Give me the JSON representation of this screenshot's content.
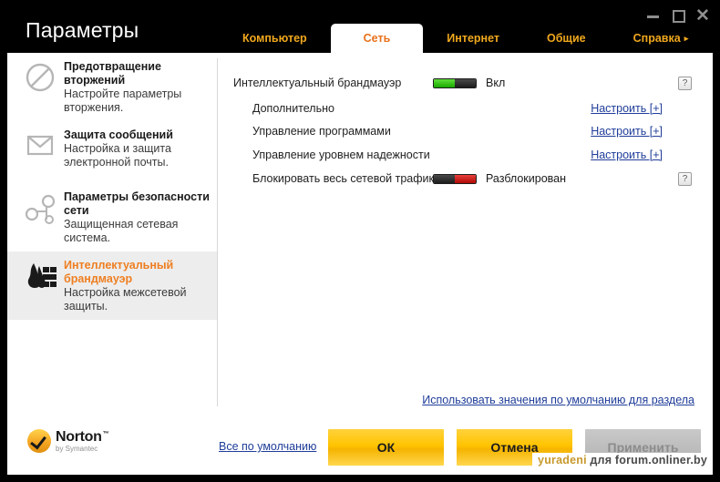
{
  "window": {
    "title": "Параметры",
    "controls": {
      "minimize": "minimize-icon",
      "maximize": "maximize-icon",
      "close": "close-icon"
    }
  },
  "tabs": [
    {
      "label": "Компьютер",
      "active": false,
      "caret": ""
    },
    {
      "label": "Сеть",
      "active": true,
      "caret": ""
    },
    {
      "label": "Интернет",
      "active": false,
      "caret": ""
    },
    {
      "label": "Общие",
      "active": false,
      "caret": ""
    },
    {
      "label": "Справка",
      "active": false,
      "caret": "▸"
    }
  ],
  "sidebar": {
    "items": [
      {
        "icon": "no-entry-icon",
        "title": "Предотвращение вторжений",
        "desc": "Настройте параметры вторжения.",
        "selected": false
      },
      {
        "icon": "envelope-icon",
        "title": "Защита сообщений",
        "desc": "Настройка и защита электронной почты.",
        "selected": false
      },
      {
        "icon": "network-nodes-icon",
        "title": "Параметры безопасности сети",
        "desc": "Защищенная сетевая система.",
        "selected": false
      },
      {
        "icon": "firewall-flame-icon",
        "title": "Интеллектуальный брандмауэр",
        "desc": "Настройка межсетевой защиты.",
        "selected": true
      }
    ]
  },
  "content": {
    "rows": [
      {
        "label": "Интеллектуальный брандмауэр",
        "indent": 0,
        "control": "toggle",
        "toggle_state": "on",
        "state_text": "Вкл",
        "help": "?"
      },
      {
        "label": "Дополнительно",
        "indent": 1,
        "control": "link",
        "link_text": "Настроить [+]"
      },
      {
        "label": "Управление программами",
        "indent": 1,
        "control": "link",
        "link_text": "Настроить [+]"
      },
      {
        "label": "Управление уровнем надежности",
        "indent": 1,
        "control": "link",
        "link_text": "Настроить [+]"
      },
      {
        "label": "Блокировать весь сетевой трафик",
        "indent": 1,
        "control": "toggle",
        "toggle_state": "off",
        "state_text": "Разблокирован",
        "help": "?"
      }
    ],
    "section_default_link": "Использовать значения по умолчанию для раздела"
  },
  "footer": {
    "brand_name": "Norton",
    "brand_sub": "by Symantec",
    "all_default_link": "Все по умолчанию",
    "buttons": [
      {
        "id": "ok",
        "label": "ОК",
        "style": "primary"
      },
      {
        "id": "cancel",
        "label": "Отмена",
        "style": "primary"
      },
      {
        "id": "apply",
        "label": "Применить",
        "style": "disabled"
      }
    ]
  },
  "watermark": {
    "part_a": "yuradeni",
    "part_b": " для forum.onliner.by"
  },
  "colors": {
    "accent_orange": "#ee7f22",
    "tab_gold": "#f0a81e",
    "link_blue": "#1f3d99",
    "button_yellow": "#ffc400",
    "toggle_green": "#19a800",
    "toggle_red": "#b00a06"
  }
}
